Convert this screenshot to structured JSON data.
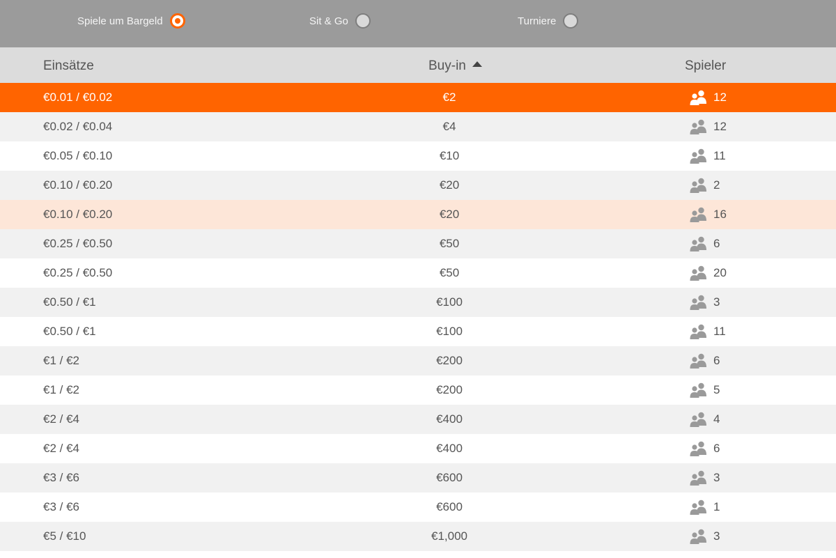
{
  "filters": {
    "cash_label": "Spiele um Bargeld",
    "sng_label": "Sit & Go",
    "tournaments_label": "Turniere",
    "selected": "cash"
  },
  "columns": {
    "stakes": "Einsätze",
    "buyin": "Buy-in",
    "players": "Spieler",
    "sort_column": "buyin",
    "sort_direction": "ascending"
  },
  "rows": [
    {
      "stakes": "€0.01 / €0.02",
      "buyin": "€2",
      "players": "12",
      "state": "selected"
    },
    {
      "stakes": "€0.02 / €0.04",
      "buyin": "€4",
      "players": "12"
    },
    {
      "stakes": "€0.05 / €0.10",
      "buyin": "€10",
      "players": "11"
    },
    {
      "stakes": "€0.10 / €0.20",
      "buyin": "€20",
      "players": "2"
    },
    {
      "stakes": "€0.10 / €0.20",
      "buyin": "€20",
      "players": "16",
      "state": "hover"
    },
    {
      "stakes": "€0.25 / €0.50",
      "buyin": "€50",
      "players": "6"
    },
    {
      "stakes": "€0.25 / €0.50",
      "buyin": "€50",
      "players": "20"
    },
    {
      "stakes": "€0.50 / €1",
      "buyin": "€100",
      "players": "3"
    },
    {
      "stakes": "€0.50 / €1",
      "buyin": "€100",
      "players": "11"
    },
    {
      "stakes": "€1 / €2",
      "buyin": "€200",
      "players": "6"
    },
    {
      "stakes": "€1 / €2",
      "buyin": "€200",
      "players": "5"
    },
    {
      "stakes": "€2 / €4",
      "buyin": "€400",
      "players": "4"
    },
    {
      "stakes": "€2 / €4",
      "buyin": "€400",
      "players": "6"
    },
    {
      "stakes": "€3 / €6",
      "buyin": "€600",
      "players": "3"
    },
    {
      "stakes": "€3 / €6",
      "buyin": "€600",
      "players": "1"
    },
    {
      "stakes": "€5 / €10",
      "buyin": "€1,000",
      "players": "3"
    }
  ],
  "icons": {
    "players": "people-icon",
    "sort": "sort-ascending-arrow"
  },
  "colors": {
    "accent": "#ff6400",
    "topbar": "#9b9b9b",
    "header": "#dcdcdc",
    "row_alt": "#f1f1f1",
    "row_hover": "#fde6d8"
  }
}
